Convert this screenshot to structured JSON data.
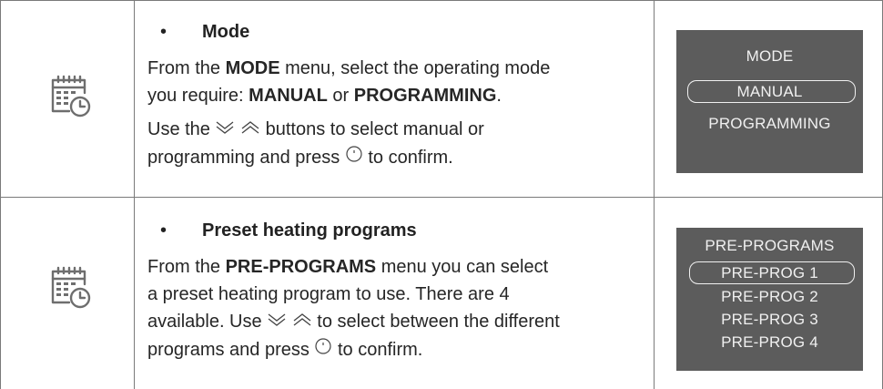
{
  "rows": [
    {
      "icon": "calendar-clock-icon",
      "bullet": "•",
      "heading": "Mode",
      "para1": {
        "t1": "From the ",
        "b1": "MODE",
        "t2": " menu, select the operating mode",
        "t3": "you require: ",
        "b2": "MANUAL",
        "t4": " or ",
        "b3": "PROGRAMMING",
        "t5": "."
      },
      "para2": {
        "t1": "Use the ",
        "t2": " buttons to select manual or",
        "t3": "programming and press ",
        "t4": " to confirm."
      },
      "screen": {
        "title": "MODE",
        "items": [
          "MANUAL",
          "PROGRAMMING"
        ],
        "selected": "MANUAL"
      }
    },
    {
      "icon": "calendar-clock-icon",
      "bullet": "•",
      "heading": "Preset heating programs",
      "para1": {
        "t1": "From the ",
        "b1": "PRE-PROGRAMS",
        "t2": " menu you can select",
        "t3": "a preset heating program to use. There are 4",
        "t4": "available. Use ",
        "t5": " to select between the different",
        "t6": "programs and press ",
        "t7": " to confirm."
      },
      "screen": {
        "title": "PRE-PROGRAMS",
        "items": [
          "PRE-PROG 1",
          "PRE-PROG 2",
          "PRE-PROG 3",
          "PRE-PROG 4"
        ],
        "selected": "PRE-PROG 1"
      }
    }
  ],
  "colors": {
    "screen_bg": "#5c5c5c",
    "screen_text": "#f0f0f0",
    "border": "#7a7a7a"
  }
}
